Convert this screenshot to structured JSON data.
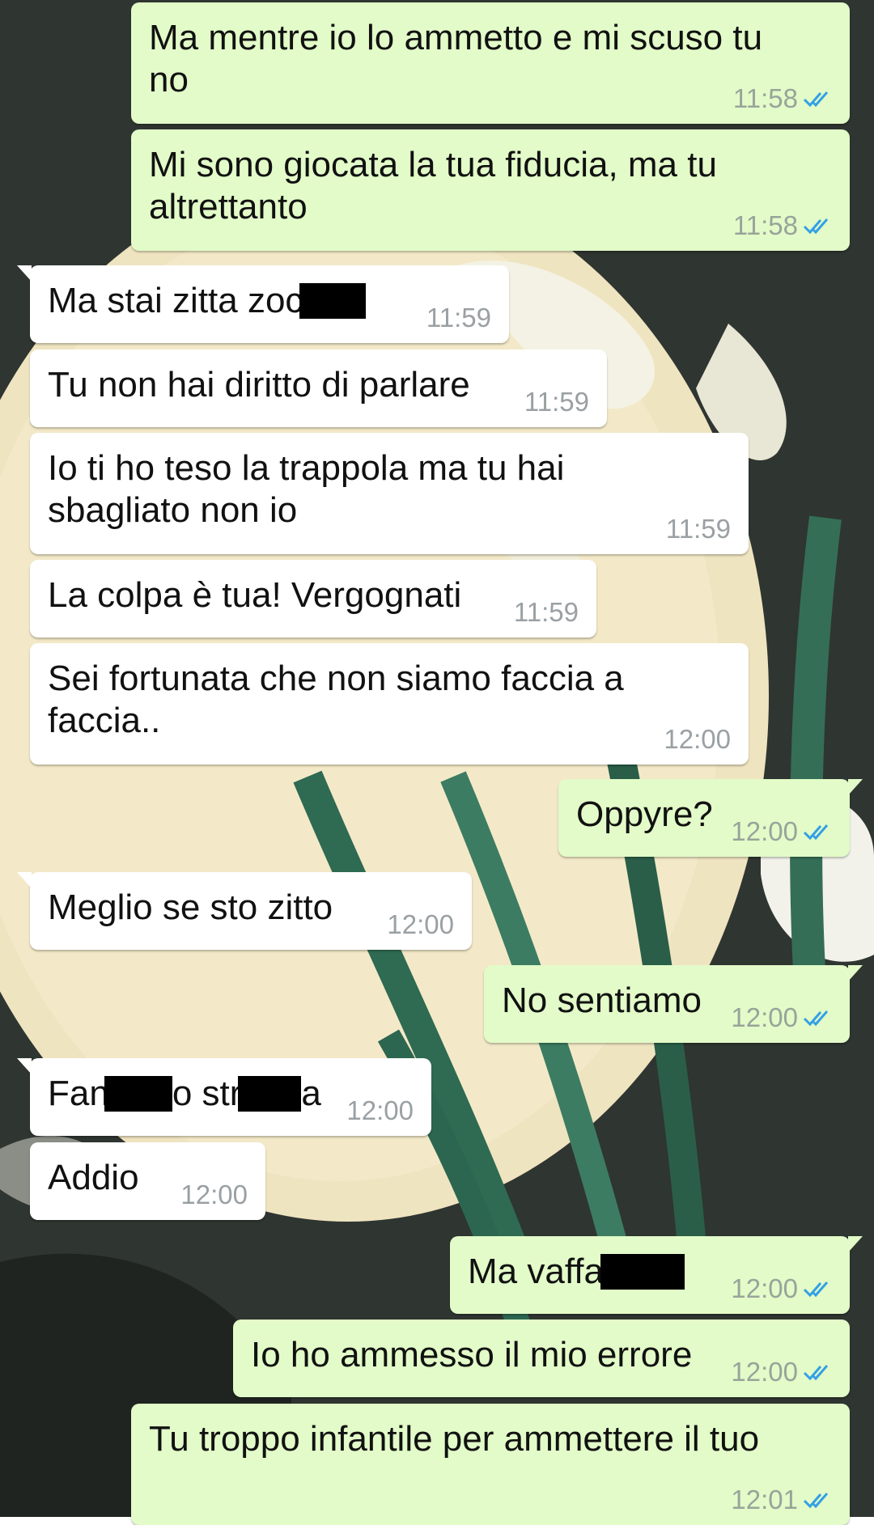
{
  "colors": {
    "incoming_bubble": "#ffffff",
    "outgoing_bubble": "#e2fbc8",
    "read_ticks": "#34a0e6",
    "timestamp": "#98a49a"
  },
  "icons": {
    "read_receipt": "double-check-icon"
  },
  "messages": [
    {
      "direction": "out",
      "text": "Ma mentre io lo ammetto e mi scuso tu\nno",
      "time": "11:58"
    },
    {
      "direction": "out",
      "text": "Mi sono giocata la tua fiducia, ma tu\naltrettanto",
      "time": "11:58"
    },
    {
      "direction": "in",
      "text_before": "Ma stai zitta zoc",
      "text_after": "",
      "time": "11:59"
    },
    {
      "direction": "in",
      "text": "Tu non hai diritto di parlare",
      "time": "11:59"
    },
    {
      "direction": "in",
      "text": "Io ti ho teso la trappola ma tu hai\nsbagliato non io",
      "time": "11:59"
    },
    {
      "direction": "in",
      "text": "La colpa è tua! Vergognati",
      "time": "11:59"
    },
    {
      "direction": "in",
      "text": "Sei fortunata che non siamo faccia a\nfaccia..",
      "time": "12:00"
    },
    {
      "direction": "out",
      "text": "Oppyre?",
      "time": "12:00"
    },
    {
      "direction": "in",
      "text": "Meglio se sto zitto",
      "time": "12:00"
    },
    {
      "direction": "out",
      "text": "No sentiamo",
      "time": "12:00"
    },
    {
      "direction": "in",
      "text_a": "Fan",
      "text_b": "o str",
      "text_c": "a",
      "time": "12:00"
    },
    {
      "direction": "in",
      "text": "Addio",
      "time": "12:00"
    },
    {
      "direction": "out",
      "text_before": "Ma vaffa",
      "time": "12:00"
    },
    {
      "direction": "out",
      "text": "Io ho ammesso il mio errore",
      "time": "12:00"
    },
    {
      "direction": "out",
      "text": "Tu troppo infantile per ammettere il tuo",
      "time": "12:01"
    }
  ]
}
